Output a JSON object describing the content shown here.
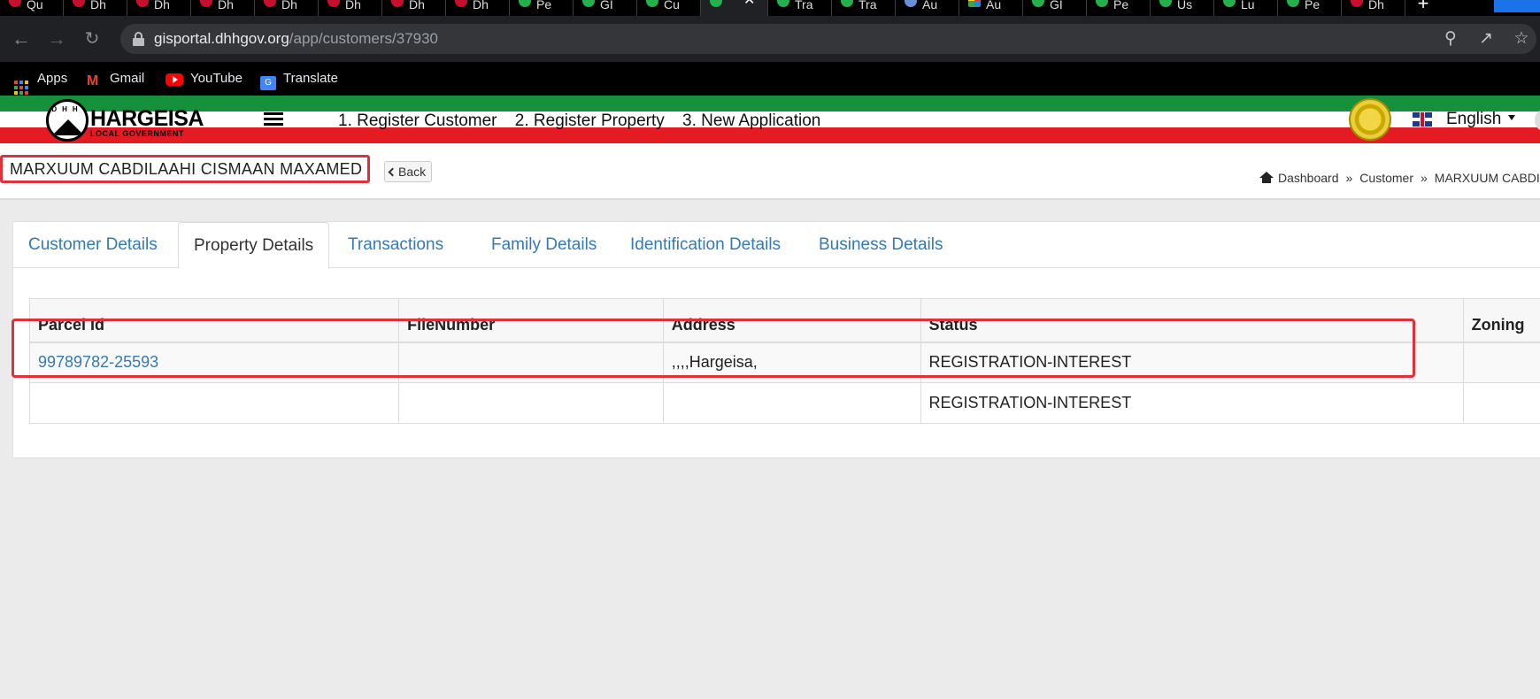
{
  "browser": {
    "tabs": [
      {
        "label": "Qu",
        "favicon": "dhh-icon",
        "color": "red"
      },
      {
        "label": "Dh",
        "favicon": "dhh-icon",
        "color": "red"
      },
      {
        "label": "Dh",
        "favicon": "dhh-icon",
        "color": "red"
      },
      {
        "label": "Dh",
        "favicon": "dhh-icon",
        "color": "red"
      },
      {
        "label": "Dh",
        "favicon": "dhh-icon",
        "color": "red"
      },
      {
        "label": "Dh",
        "favicon": "dhh-icon",
        "color": "red"
      },
      {
        "label": "Dh",
        "favicon": "dhh-icon",
        "color": "red"
      },
      {
        "label": "Dh",
        "favicon": "dhh-icon",
        "color": "red"
      },
      {
        "label": "Pe",
        "favicon": "check-circle-icon",
        "color": "green"
      },
      {
        "label": "GI",
        "favicon": "check-circle-icon",
        "color": "green"
      },
      {
        "label": "Cu",
        "favicon": "check-circle-icon",
        "color": "green"
      },
      {
        "label": "",
        "favicon": "check-circle-icon",
        "color": "green",
        "active": true
      },
      {
        "label": "Tra",
        "favicon": "check-circle-icon",
        "color": "green"
      },
      {
        "label": "Tra",
        "favicon": "check-circle-icon",
        "color": "green"
      },
      {
        "label": "Au",
        "favicon": "globe-icon",
        "color": "blue"
      },
      {
        "label": "Au",
        "favicon": "drive-icon",
        "color": "multi"
      },
      {
        "label": "GI",
        "favicon": "check-circle-icon",
        "color": "green"
      },
      {
        "label": "Pe",
        "favicon": "check-circle-icon",
        "color": "green"
      },
      {
        "label": "Us",
        "favicon": "check-circle-icon",
        "color": "green"
      },
      {
        "label": "Lu",
        "favicon": "check-circle-icon",
        "color": "green"
      },
      {
        "label": "Pe",
        "favicon": "check-circle-icon",
        "color": "green"
      },
      {
        "label": "Dh",
        "favicon": "dhh-icon",
        "color": "red"
      }
    ],
    "new_tab": "+",
    "close_glyph": "✕",
    "url_host": "gisportal.dhhgov.org",
    "url_path": "/app/customers/37930",
    "bookmarks": [
      {
        "label": "Apps",
        "icon": "apps-grid-icon"
      },
      {
        "label": "Gmail",
        "icon": "gmail-icon"
      },
      {
        "label": "YouTube",
        "icon": "youtube-icon"
      },
      {
        "label": "Translate",
        "icon": "translate-icon"
      }
    ]
  },
  "header": {
    "logo_letters": "DHH",
    "brand": "HARGEISA",
    "brand_sub": "LOCAL GOVERNMENT",
    "menu": [
      "1. Register Customer",
      "2. Register Property",
      "3. New Application"
    ],
    "language": "English",
    "colors": {
      "green": "#15913b",
      "red": "#e41b23"
    }
  },
  "page": {
    "title": "MARXUUM CABDILAAHI CISMAAN MAXAMED",
    "back_label": "Back",
    "breadcrumb": [
      "Dashboard",
      "Customer",
      "MARXUUM CABDILA"
    ],
    "breadcrumb_sep": "»"
  },
  "tabs": [
    {
      "label": "Customer Details",
      "active": false
    },
    {
      "label": "Property Details",
      "active": true
    },
    {
      "label": "Transactions",
      "active": false
    },
    {
      "label": "Family Details",
      "active": false
    },
    {
      "label": "Identification Details",
      "active": false
    },
    {
      "label": "Business Details",
      "active": false
    }
  ],
  "table": {
    "columns": [
      "Parcel Id",
      "FileNumber",
      "Address",
      "Status",
      "Zoning"
    ],
    "rows": [
      {
        "parcel_id": "99789782-25593",
        "file_number": "",
        "address": ",,,,Hargeisa,",
        "status": "REGISTRATION-INTEREST",
        "zoning": ""
      },
      {
        "parcel_id": "",
        "file_number": "",
        "address": "",
        "status": "REGISTRATION-INTEREST",
        "zoning": ""
      }
    ]
  }
}
